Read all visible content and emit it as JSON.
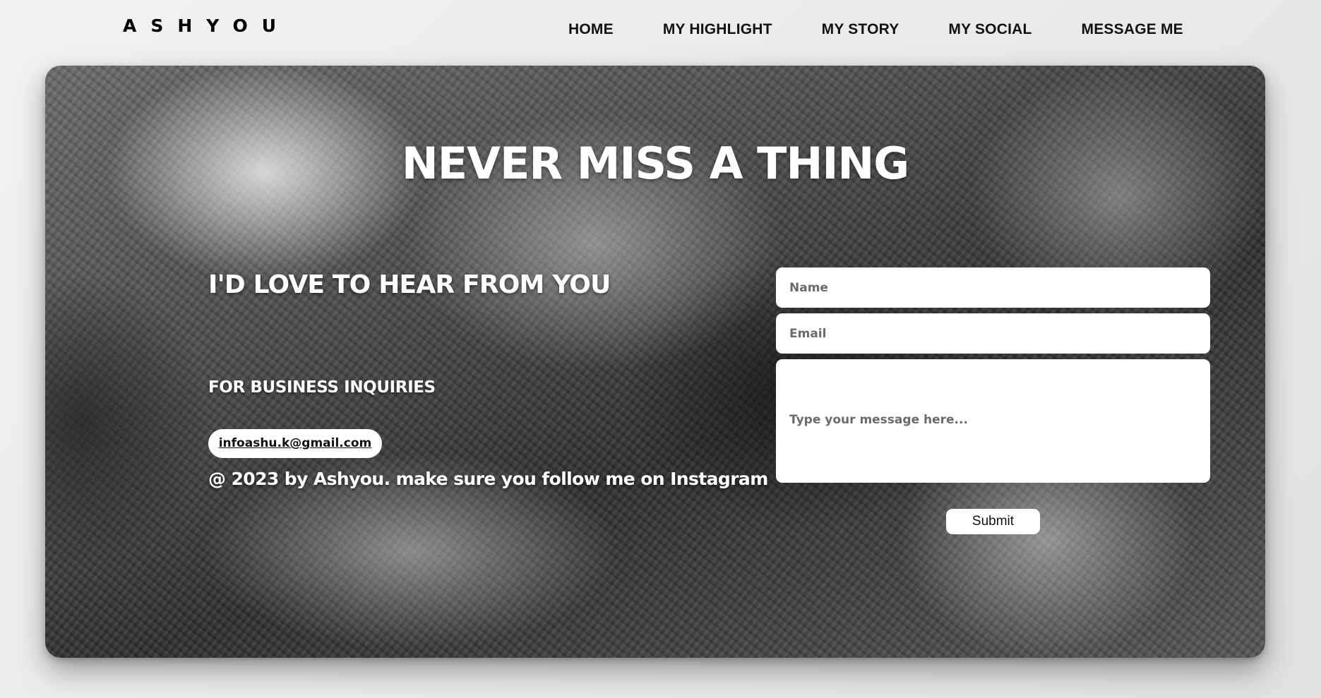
{
  "header": {
    "logo": "ASHYOU",
    "nav": [
      {
        "label": "HOME"
      },
      {
        "label": "MY HIGHLIGHT"
      },
      {
        "label": "MY STORY"
      },
      {
        "label": "MY SOCIAL"
      },
      {
        "label": "MESSAGE ME"
      }
    ]
  },
  "hero": {
    "title": "NEVER MISS A THING",
    "subheading": "I'D LOVE TO HEAR FROM YOU",
    "business_label": "FOR BUSINESS INQUIRIES",
    "email": "infoashu.k@gmail.com",
    "copyright": "@ 2023 by Ashyou. make sure you follow me on Instagram"
  },
  "form": {
    "name_placeholder": "Name",
    "email_placeholder": "Email",
    "message_placeholder": "Type your message here...",
    "submit_label": "Submit"
  },
  "colors": {
    "text_dark": "#111111",
    "text_light": "#ffffff",
    "page_bg": "#efedec"
  }
}
